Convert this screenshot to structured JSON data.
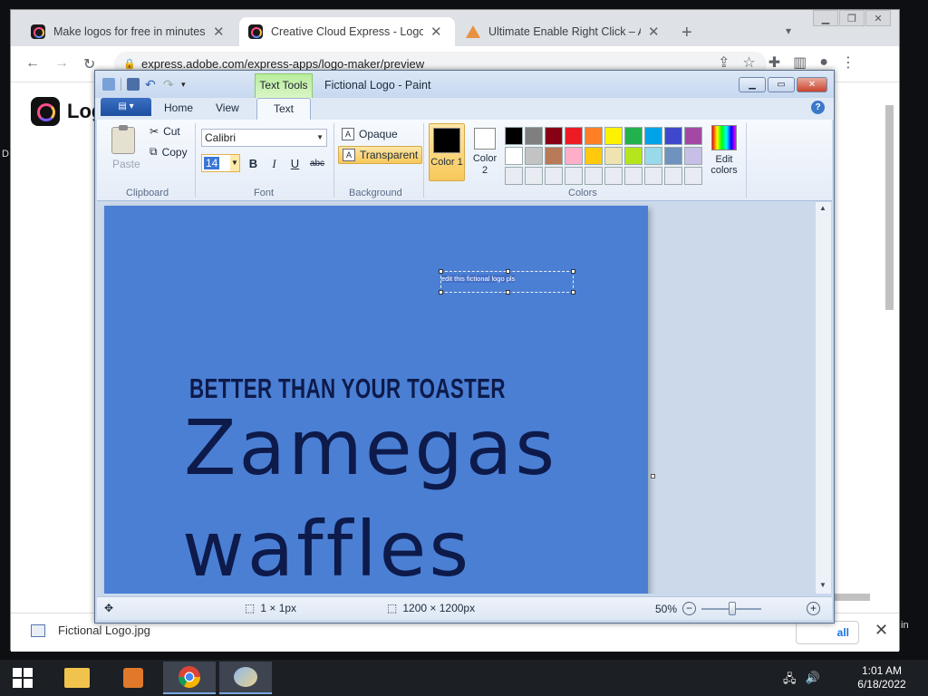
{
  "desktop": {
    "edge_left": "D",
    "edge_right": "in"
  },
  "browser": {
    "tabs": [
      {
        "title": "Make logos for free in minutes.",
        "favicon": "adobe-express-icon"
      },
      {
        "title": "Creative Cloud Express - Logo M",
        "favicon": "adobe-express-icon"
      },
      {
        "title": "Ultimate Enable Right Click – Allo",
        "favicon": "extension-icon"
      }
    ],
    "new_tab_symbol": "+",
    "tab_close_symbol": "✕",
    "url": "express.adobe.com/express-apps/logo-maker/preview",
    "page_title": "Log",
    "download_filename": "Fictional Logo.jpg",
    "show_all": "all"
  },
  "paint": {
    "context_tab": "Text Tools",
    "title": "Fictional Logo - Paint",
    "tabs": {
      "home": "Home",
      "view": "View",
      "text": "Text"
    },
    "clipboard": {
      "paste": "Paste",
      "cut": "Cut",
      "copy": "Copy",
      "label": "Clipboard"
    },
    "font": {
      "name": "Calibri",
      "size": "14",
      "bold": "B",
      "italic": "I",
      "underline": "U",
      "strike": "abc",
      "label": "Font"
    },
    "background": {
      "opaque": "Opaque",
      "transparent": "Transparent",
      "label": "Background"
    },
    "colors": {
      "color1_label": "Color 1",
      "color2_label": "Color 2",
      "color1_value": "#000000",
      "color2_value": "#ffffff",
      "label": "Colors",
      "edit": "Edit colors",
      "palette": [
        "#000000",
        "#7f7f7f",
        "#880015",
        "#ed1c24",
        "#ff7f27",
        "#fff200",
        "#22b14c",
        "#00a2e8",
        "#3f48cc",
        "#a349a4",
        "#ffffff",
        "#c3c3c3",
        "#b97a57",
        "#ffaec9",
        "#ffc90e",
        "#efe4b0",
        "#b5e61d",
        "#99d9ea",
        "#7092be",
        "#c8bfe7",
        "#e8ecf2",
        "#e8ecf2",
        "#e8ecf2",
        "#e8ecf2",
        "#e8ecf2",
        "#e8ecf2",
        "#e8ecf2",
        "#e8ecf2",
        "#e8ecf2",
        "#e8ecf2"
      ]
    },
    "canvas": {
      "background": "#4a7fd4",
      "text_box": "edit this fictional logo pls",
      "slogan": "BETTER THAN YOUR TOASTER",
      "line1": "Zamegas",
      "line2": "waffles"
    },
    "status": {
      "selection_size": "1 × 1px",
      "image_size": "1200 × 1200px",
      "zoom": "50%"
    }
  },
  "taskbar": {
    "time": "1:01 AM",
    "date": "6/18/2022"
  }
}
